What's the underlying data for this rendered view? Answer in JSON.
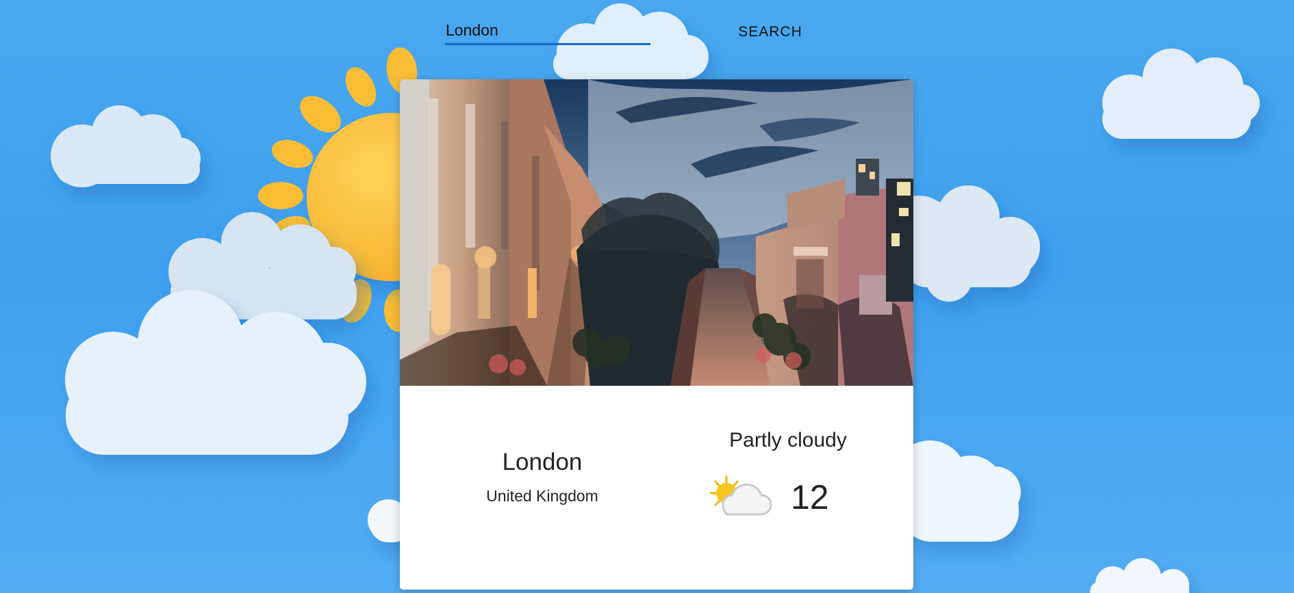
{
  "search": {
    "value": "London",
    "button_label": "SEARCH"
  },
  "weather": {
    "city": "London",
    "country": "United Kingdom",
    "condition": "Partly cloudy",
    "temperature": "12",
    "icon": "partly-cloudy-icon"
  },
  "background": {
    "icons": [
      "sun-icon",
      "cloud-icon"
    ]
  },
  "colors": {
    "sky": "#3fa0ee",
    "cloud": "#dcecff",
    "sun": "#f9bd36",
    "input_underline": "#1667c8"
  }
}
